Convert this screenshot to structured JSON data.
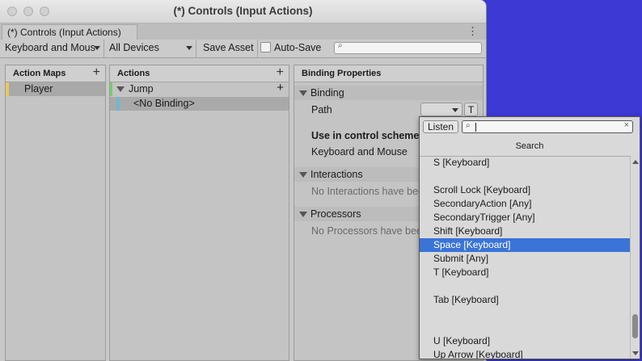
{
  "window": {
    "title": "(*) Controls (Input Actions)",
    "tab_label": "(*) Controls (Input Actions)"
  },
  "toolbar": {
    "scheme": "Keyboard and Mous",
    "devices": "All Devices",
    "save": "Save Asset",
    "autosave": "Auto-Save",
    "search_placeholder": ""
  },
  "action_maps": {
    "header": "Action Maps",
    "items": [
      "Player"
    ]
  },
  "actions": {
    "header": "Actions",
    "action": "Jump",
    "binding": "<No Binding>"
  },
  "binding_properties": {
    "header": "Binding Properties",
    "binding_section": "Binding",
    "path_label": "Path",
    "t_button": "T",
    "use_in_scheme": "Use in control scheme",
    "scheme_value": "Keyboard and Mouse",
    "interactions_section": "Interactions",
    "interactions_empty": "No Interactions have bee",
    "processors_section": "Processors",
    "processors_empty": "No Processors have bee"
  },
  "popup": {
    "listen": "Listen",
    "search_value": "",
    "header": "Search",
    "items": [
      "S [Keyboard]",
      "",
      "Scroll Lock [Keyboard]",
      "SecondaryAction [Any]",
      "SecondaryTrigger [Any]",
      "Shift [Keyboard]",
      "Space [Keyboard]",
      "Submit [Any]",
      "T [Keyboard]",
      "",
      "Tab [Keyboard]",
      "",
      "",
      "U [Keyboard]",
      "Up Arrow [Keyboard]"
    ],
    "selected_index": 6
  },
  "colors": {
    "desktop": "#3c39d4",
    "selection": "#3a74d6",
    "player_marker": "#e8c95c",
    "action_marker": "#6fcf6f",
    "binding_marker": "#6fb7d6"
  }
}
